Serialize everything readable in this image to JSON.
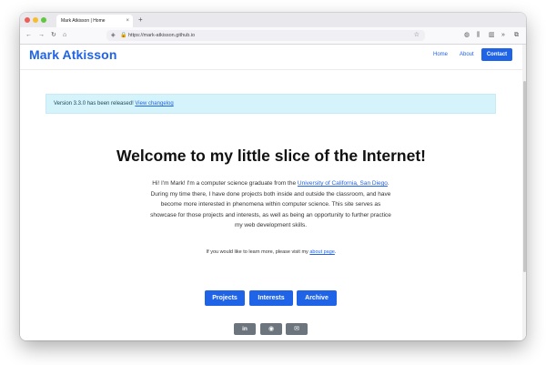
{
  "browser": {
    "tab_title": "Mark Atkisson | Home",
    "tab_close": "×",
    "new_tab": "+",
    "url": "https://mark-atkisson.github.io",
    "icons": {
      "back": "←",
      "forward": "→",
      "reload": "↻",
      "home": "⌂",
      "shield": "◈",
      "lock": "🔒",
      "star": "☆",
      "pocket": "◍",
      "library": "⫼",
      "sidebar": "▥",
      "overflow": "»",
      "extension": "⧉"
    }
  },
  "nav": {
    "brand": "Mark Atkisson",
    "home": "Home",
    "about": "About",
    "contact": "Contact"
  },
  "alert": {
    "text": "Version 3.3.0 has been released! ",
    "link": "View changelog"
  },
  "hero": {
    "headline": "Welcome to my little slice of the Internet!",
    "intro_1": "Hi! I'm Mark! I'm a computer science graduate from the ",
    "intro_link": "University of California, San Diego",
    "intro_2": ". During my time there, I have done projects both inside and outside the classroom, and have become more interested in phenomena within computer science. This site serves as showcase for those projects and interests, as well as being an opportunity to further practice my web development skills.",
    "learn_1": "If you would like to learn more, please visit my ",
    "learn_link": "about page",
    "learn_2": "."
  },
  "buttons": {
    "projects": "Projects",
    "interests": "Interests",
    "archive": "Archive"
  },
  "social": {
    "linkedin": "in",
    "github": "◉",
    "email": "✉"
  },
  "colors": {
    "primary": "#1f63e6",
    "alert_bg": "#d5f3fb",
    "social_bg": "#6c757d"
  }
}
